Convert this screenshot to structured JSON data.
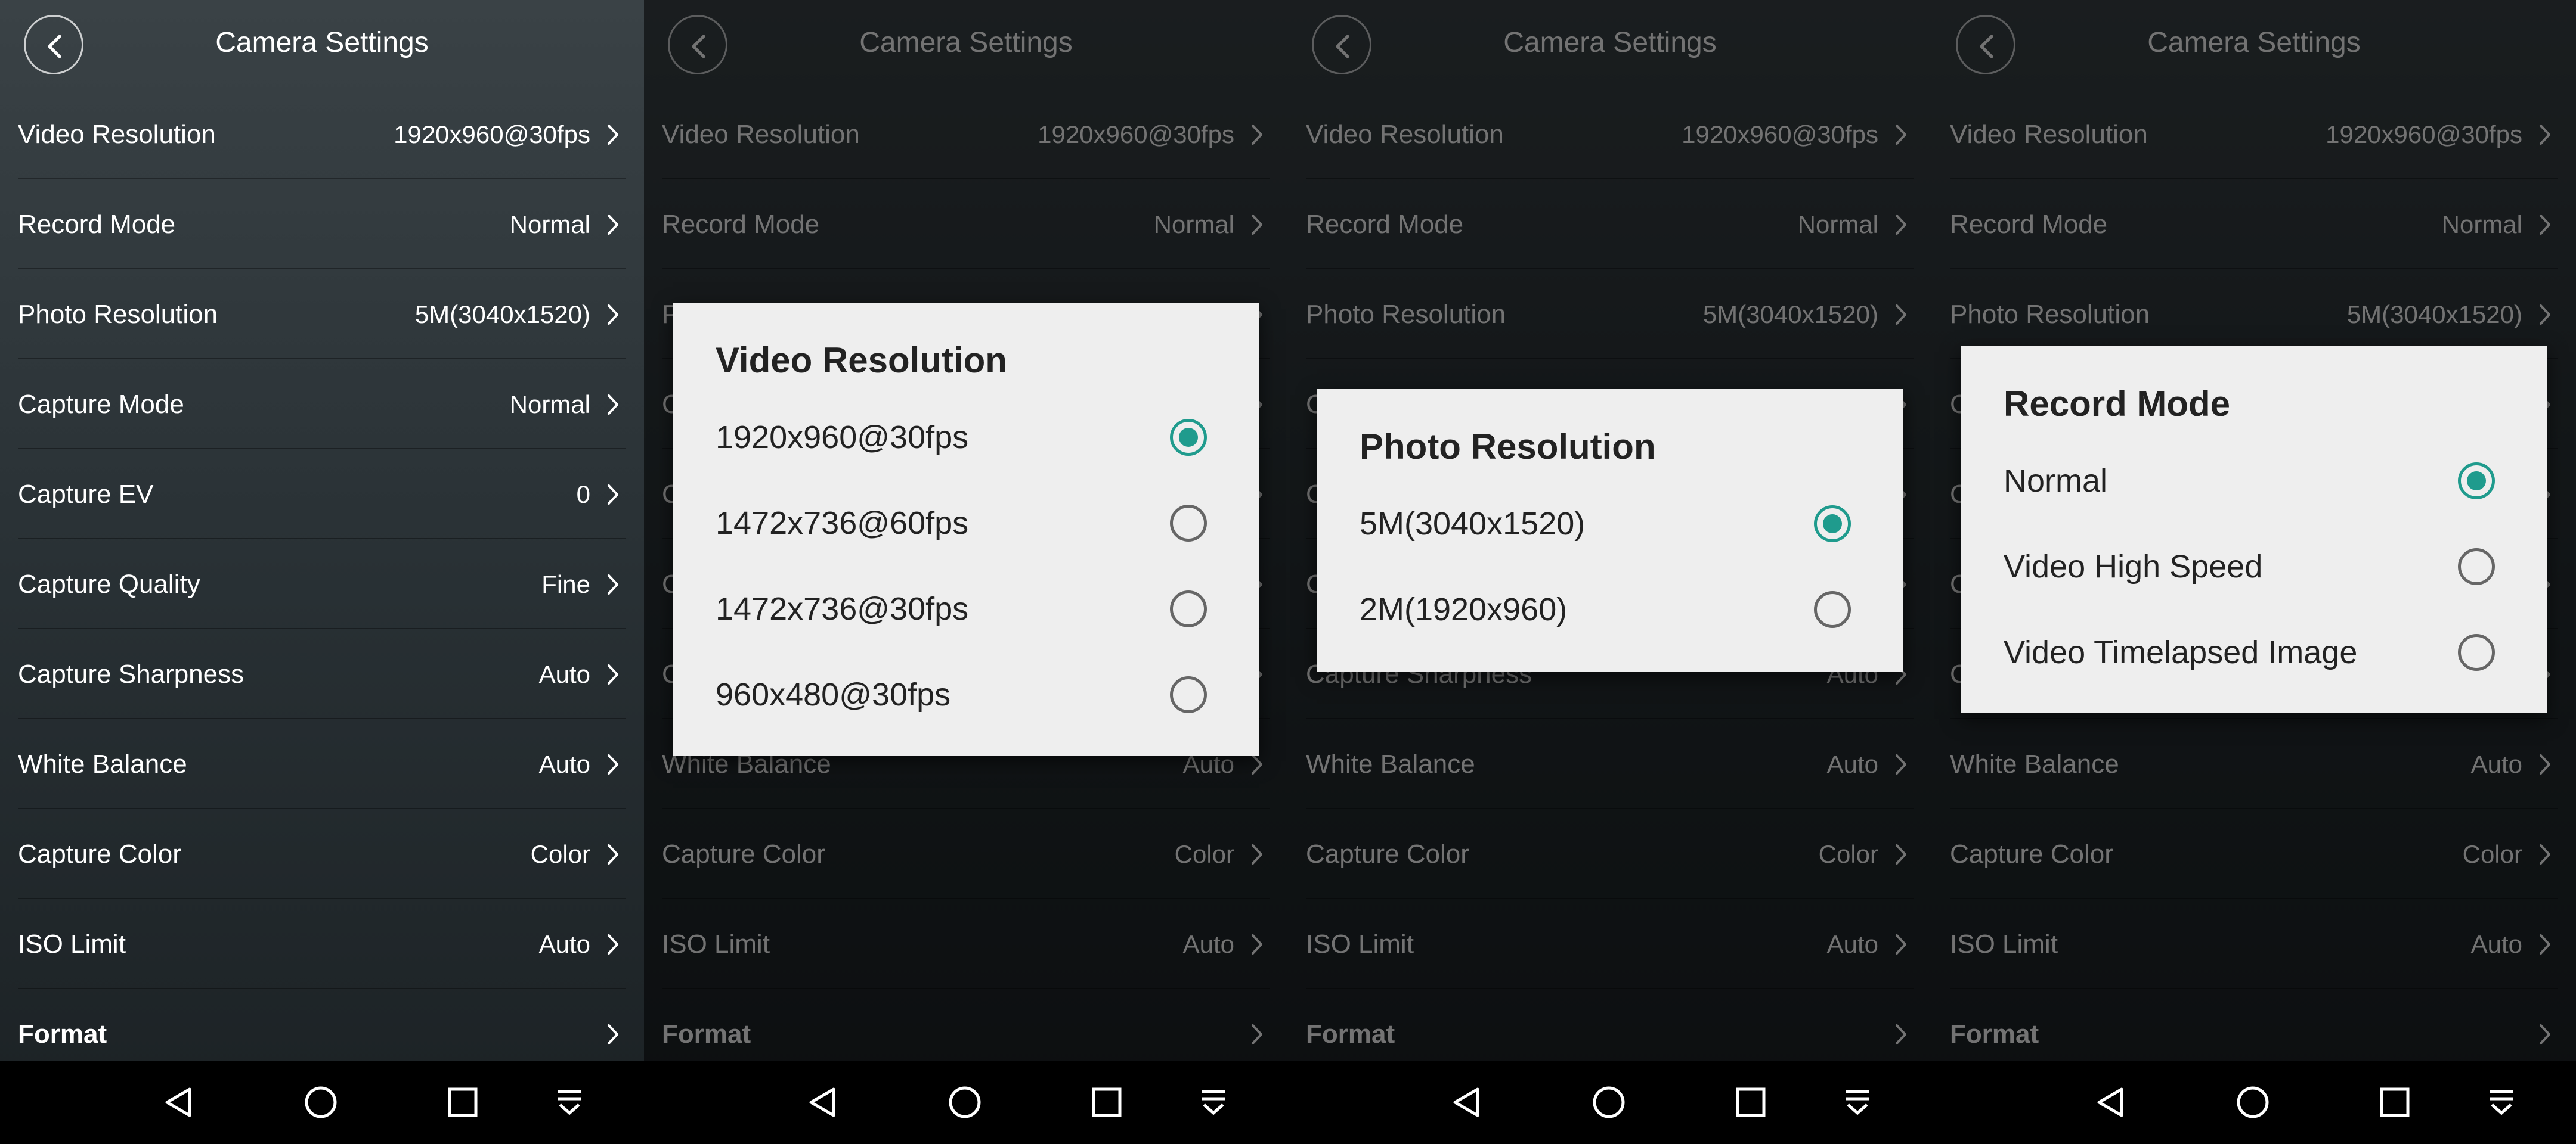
{
  "screen_title": "Camera Settings",
  "settings": [
    {
      "label": "Video Resolution",
      "value": "1920x960@30fps"
    },
    {
      "label": "Record Mode",
      "value": "Normal"
    },
    {
      "label": "Photo Resolution",
      "value": "5M(3040x1520)"
    },
    {
      "label": "Capture Mode",
      "value": "Normal"
    },
    {
      "label": "Capture EV",
      "value": "0"
    },
    {
      "label": "Capture Quality",
      "value": "Fine"
    },
    {
      "label": "Capture Sharpness",
      "value": "Auto"
    },
    {
      "label": "White Balance",
      "value": "Auto"
    },
    {
      "label": "Capture Color",
      "value": "Color"
    },
    {
      "label": "ISO Limit",
      "value": "Auto"
    },
    {
      "label": "Format",
      "value": ""
    }
  ],
  "dialogs": {
    "video_resolution": {
      "title": "Video Resolution",
      "options": [
        "1920x960@30fps",
        "1472x736@60fps",
        "1472x736@30fps",
        "960x480@30fps"
      ],
      "selected": "1920x960@30fps"
    },
    "photo_resolution": {
      "title": "Photo Resolution",
      "options": [
        "5M(3040x1520)",
        "2M(1920x960)"
      ],
      "selected": "5M(3040x1520)"
    },
    "record_mode": {
      "title": "Record Mode",
      "options": [
        "Normal",
        "Video High Speed",
        "Video Timelapsed Image"
      ],
      "selected": "Normal"
    }
  },
  "icons": {
    "back": "chevron-left-icon",
    "row": "chevron-right-icon",
    "nav": [
      "nav-back-icon",
      "nav-home-icon",
      "nav-recent-icon",
      "nav-menu-icon"
    ]
  },
  "colors": {
    "accent": "#1f9b8d",
    "dialog_bg": "#eeeeee"
  }
}
